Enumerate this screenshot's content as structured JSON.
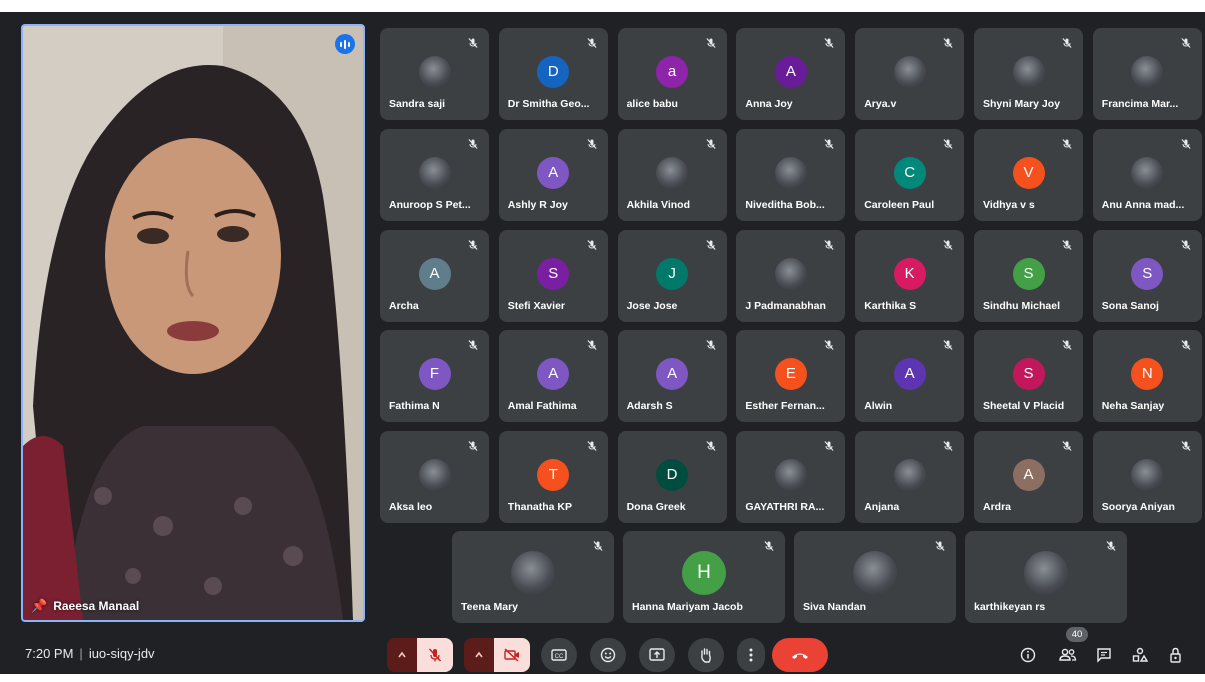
{
  "speaker": {
    "name": "Raeesa Manaal"
  },
  "meeting": {
    "time": "7:20 PM",
    "separator": "|",
    "code": "iuo-siqy-jdv"
  },
  "participant_count": "40",
  "participants": [
    {
      "name": "Sandra saji",
      "initial": "",
      "color": ""
    },
    {
      "name": "Dr Smitha Geo...",
      "initial": "D",
      "color": "#1565c0"
    },
    {
      "name": "alice babu",
      "initial": "a",
      "color": "#8e24aa"
    },
    {
      "name": "Anna Joy",
      "initial": "A",
      "color": "#6a1b9a"
    },
    {
      "name": "Arya.v",
      "initial": "",
      "color": ""
    },
    {
      "name": "Shyni Mary Joy",
      "initial": "",
      "color": ""
    },
    {
      "name": "Francima Mar...",
      "initial": "",
      "color": ""
    },
    {
      "name": "Anuroop S Pet...",
      "initial": "",
      "color": ""
    },
    {
      "name": "Ashly R Joy",
      "initial": "A",
      "color": "#7e57c2"
    },
    {
      "name": "Akhila Vinod",
      "initial": "",
      "color": ""
    },
    {
      "name": "Niveditha Bob...",
      "initial": "",
      "color": ""
    },
    {
      "name": "Caroleen Paul",
      "initial": "C",
      "color": "#00897b"
    },
    {
      "name": "Vidhya v s",
      "initial": "V",
      "color": "#f4511e"
    },
    {
      "name": "Anu Anna mad...",
      "initial": "",
      "color": ""
    },
    {
      "name": "Archa",
      "initial": "A",
      "color": "#607d8b"
    },
    {
      "name": "Stefi Xavier",
      "initial": "S",
      "color": "#7b1fa2"
    },
    {
      "name": "Jose Jose",
      "initial": "J",
      "color": "#00796b"
    },
    {
      "name": "J Padmanabhan",
      "initial": "",
      "color": ""
    },
    {
      "name": "Karthika S",
      "initial": "K",
      "color": "#d81b60"
    },
    {
      "name": "Sindhu Michael",
      "initial": "S",
      "color": "#43a047"
    },
    {
      "name": "Sona Sanoj",
      "initial": "S",
      "color": "#7e57c2"
    },
    {
      "name": "Fathima N",
      "initial": "F",
      "color": "#7e57c2"
    },
    {
      "name": "Amal Fathima",
      "initial": "A",
      "color": "#7e57c2"
    },
    {
      "name": "Adarsh S",
      "initial": "A",
      "color": "#7e57c2"
    },
    {
      "name": "Esther Fernan...",
      "initial": "E",
      "color": "#f4511e"
    },
    {
      "name": "Alwin",
      "initial": "A",
      "color": "#5e35b1"
    },
    {
      "name": "Sheetal V Placid",
      "initial": "S",
      "color": "#c2185b"
    },
    {
      "name": "Neha Sanjay",
      "initial": "N",
      "color": "#f4511e"
    },
    {
      "name": "Aksa leo",
      "initial": "",
      "color": ""
    },
    {
      "name": "Thanatha KP",
      "initial": "T",
      "color": "#f4511e"
    },
    {
      "name": "Dona Greek",
      "initial": "D",
      "color": "#004d40"
    },
    {
      "name": "GAYATHRI RA...",
      "initial": "",
      "color": ""
    },
    {
      "name": "Anjana",
      "initial": "",
      "color": ""
    },
    {
      "name": "Ardra",
      "initial": "A",
      "color": "#8d6e63"
    },
    {
      "name": "Soorya Aniyan",
      "initial": "",
      "color": ""
    }
  ],
  "last_row": [
    {
      "name": "Teena Mary",
      "initial": "",
      "color": ""
    },
    {
      "name": "Hanna Mariyam Jacob",
      "initial": "H",
      "color": "#43a047"
    },
    {
      "name": "Siva Nandan",
      "initial": "",
      "color": ""
    },
    {
      "name": "karthikeyan rs",
      "initial": "",
      "color": ""
    }
  ],
  "controls": {
    "mic_icon": "mic-off-icon",
    "camera_icon": "camera-off-icon",
    "captions_icon": "captions-icon",
    "emoji_icon": "emoji-icon",
    "present_icon": "present-icon",
    "hand_icon": "raise-hand-icon",
    "more_icon": "more-options-icon",
    "end_call_icon": "end-call-icon"
  }
}
